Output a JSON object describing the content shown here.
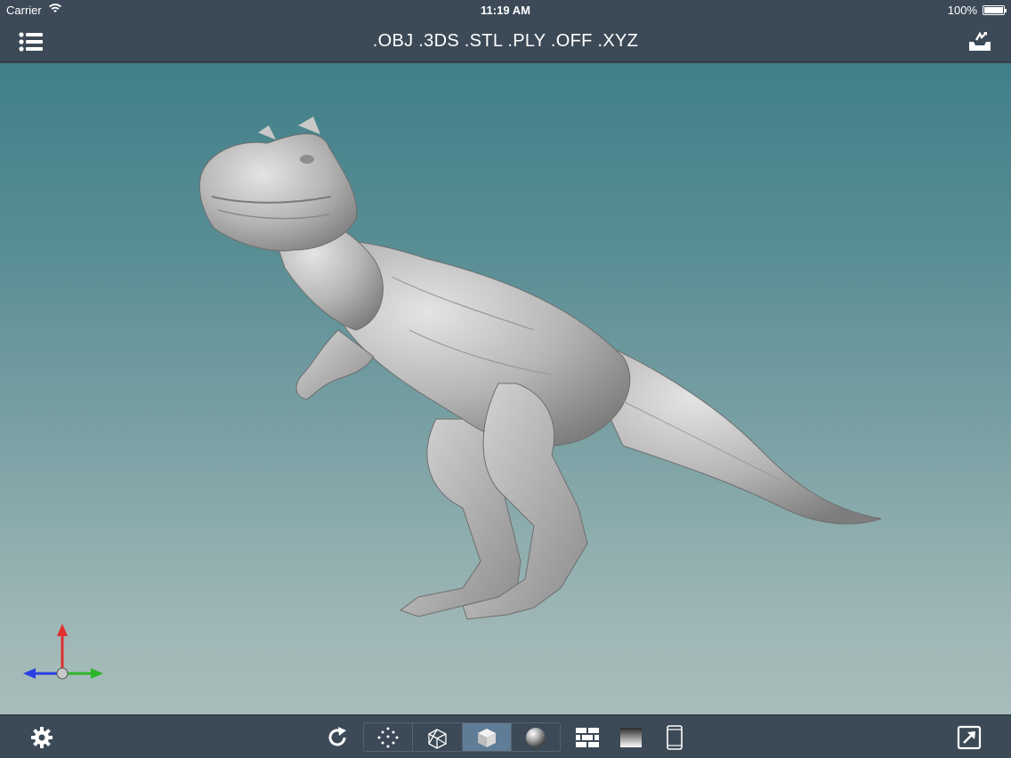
{
  "status_bar": {
    "carrier": "Carrier",
    "time": "11:19 AM",
    "battery": "100%"
  },
  "nav_bar": {
    "title": ".OBJ .3DS .STL .PLY .OFF .XYZ",
    "left_icon": "list-menu-icon",
    "right_icon": "export-tray-icon"
  },
  "viewport": {
    "model": "dinosaur-mesh",
    "axis_colors": {
      "x": "#2ab52a",
      "y": "#e03030",
      "z": "#2a3fe0"
    }
  },
  "toolbar": {
    "settings_icon": "gear-icon",
    "reset_icon": "rotate-reset-icon",
    "render_modes": [
      {
        "icon": "point-cloud-icon",
        "active": false
      },
      {
        "icon": "wireframe-cube-icon",
        "active": false
      },
      {
        "icon": "solid-cube-icon",
        "active": true
      },
      {
        "icon": "smooth-sphere-icon",
        "active": false
      }
    ],
    "background_texture_icon": "brick-wall-icon",
    "gradient_icon": "gradient-swatch-icon",
    "device_icon": "tablet-icon",
    "fullscreen_icon": "expand-arrow-icon"
  },
  "colors": {
    "bar_background": "#3c4a57",
    "active_segment": "#5f7d96",
    "viewport_top": "#417f88",
    "viewport_bottom": "#a8bdbb"
  }
}
